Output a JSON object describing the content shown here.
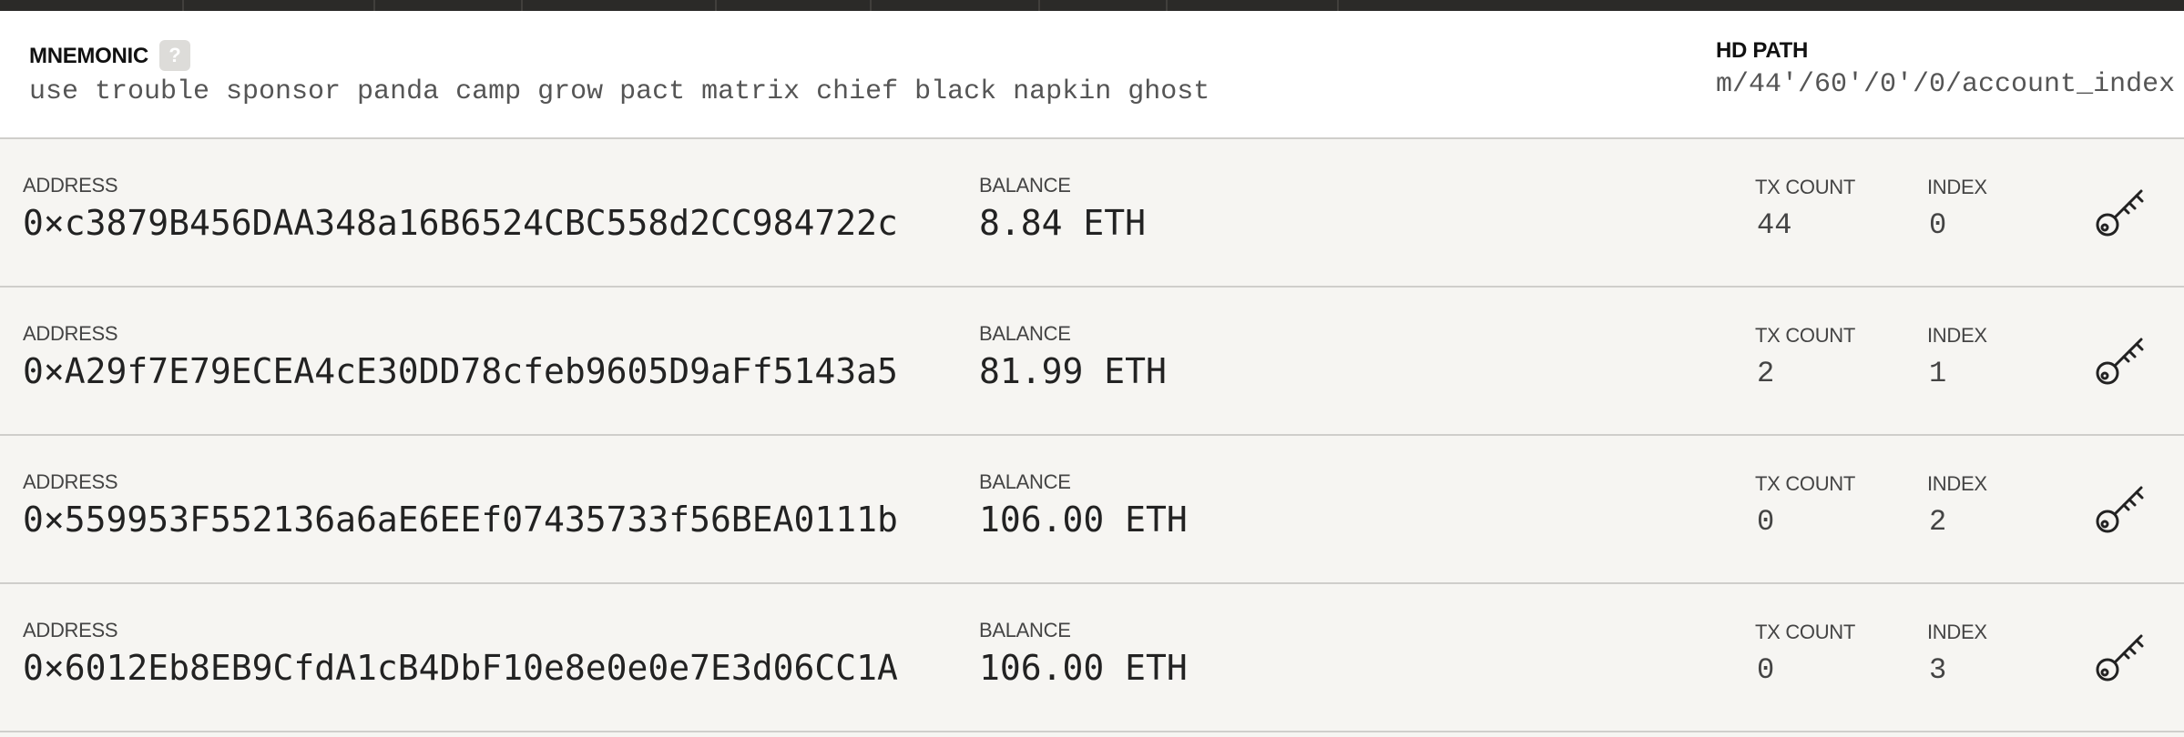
{
  "mnemonic": {
    "label": "MNEMONIC",
    "help_glyph": "?",
    "words": "use trouble sponsor panda camp grow pact matrix chief black napkin ghost"
  },
  "hd_path": {
    "label": "HD PATH",
    "value": "m/44'/60'/0'/0/account_index"
  },
  "column_labels": {
    "address": "ADDRESS",
    "balance": "BALANCE",
    "tx_count": "TX COUNT",
    "index": "INDEX"
  },
  "accounts": [
    {
      "address": "0×c3879B456DAA348a16B6524CBC558d2CC984722c",
      "balance": "8.84 ETH",
      "tx_count": "44",
      "index": "0",
      "action_icon": "key-icon"
    },
    {
      "address": "0×A29f7E79ECEA4cE30DD78cfeb9605D9aFf5143a5",
      "balance": "81.99 ETH",
      "tx_count": "2",
      "index": "1",
      "action_icon": "key-icon"
    },
    {
      "address": "0×559953F552136a6aE6EEf07435733f56BEA0111b",
      "balance": "106.00 ETH",
      "tx_count": "0",
      "index": "2",
      "action_icon": "key-icon"
    },
    {
      "address": "0×6012Eb8EB9CfdA1cB4DbF10e8e0e0e7E3d06CC1A",
      "balance": "106.00 ETH",
      "tx_count": "0",
      "index": "3",
      "action_icon": "key-icon"
    }
  ],
  "colors": {
    "top_bar": "#2b2a28",
    "panel_bg": "#ffffff",
    "row_bg": "#f6f5f2",
    "divider": "#cfcecb",
    "help_badge": "#dddcd9"
  }
}
